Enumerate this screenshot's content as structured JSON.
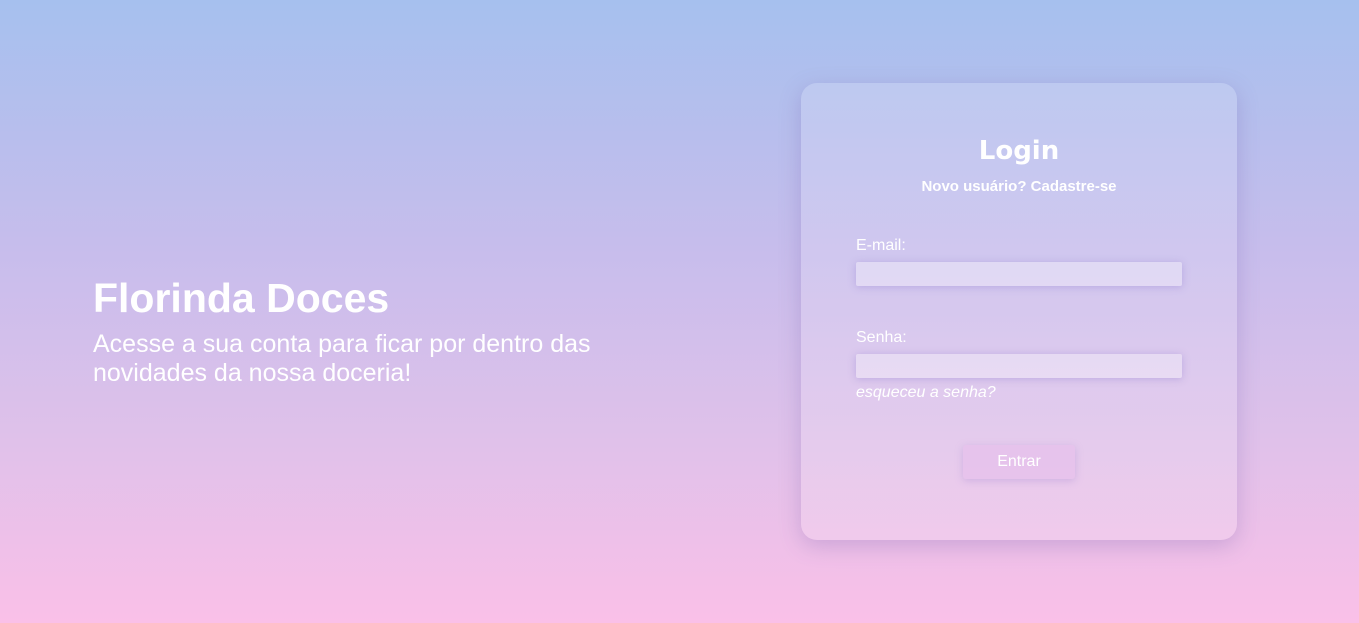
{
  "hero": {
    "title": "Florinda Doces",
    "subtitle": "Acesse a sua conta para ficar por dentro das novidades da nossa doceria!"
  },
  "login": {
    "title": "Login",
    "signup_link": "Novo usuário? Cadastre-se",
    "email_label": "E-mail:",
    "email_value": "",
    "password_label": "Senha:",
    "password_value": "",
    "forgot_link": "esqueceu a senha?",
    "submit_label": "Entrar"
  },
  "colors": {
    "gradient_top": "#a6c0ee",
    "gradient_bottom": "#fac0e8",
    "text": "#ffffff"
  }
}
